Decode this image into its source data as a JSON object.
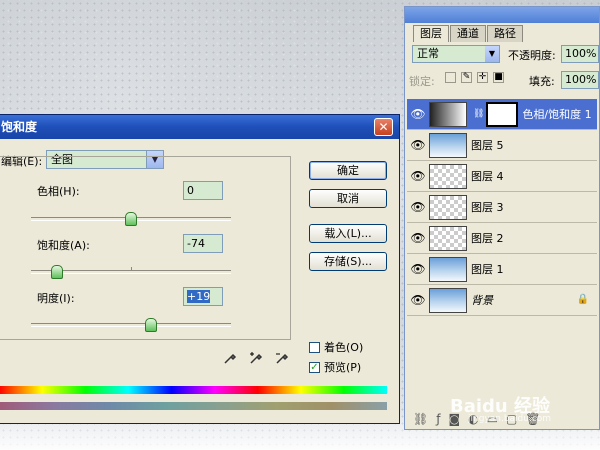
{
  "dialog": {
    "title": "饱和度",
    "close": "✕",
    "edit_label": "编辑(E):",
    "edit_value": "全图",
    "hue": {
      "label": "色相(H):",
      "value": "0"
    },
    "saturation": {
      "label": "饱和度(A):",
      "value": "-74"
    },
    "lightness": {
      "label": "明度(I):",
      "value": "+19"
    },
    "buttons": {
      "ok": "确定",
      "cancel": "取消",
      "load": "载入(L)...",
      "save": "存储(S)..."
    },
    "colorize": {
      "label": "着色(O)",
      "checked": false
    },
    "preview": {
      "label": "预览(P)",
      "checked": true
    }
  },
  "layers_panel": {
    "tabs": [
      "图层",
      "通道",
      "路径"
    ],
    "blend_mode": "正常",
    "opacity_label": "不透明度:",
    "opacity_value": "100%",
    "lock_label": "锁定:",
    "fill_label": "填充:",
    "fill_value": "100%",
    "layers": [
      {
        "name": "色相/饱和度 1",
        "type": "adjustment",
        "selected": true
      },
      {
        "name": "图层 5",
        "type": "image"
      },
      {
        "name": "图层 4",
        "type": "transparent"
      },
      {
        "name": "图层 3",
        "type": "transparent"
      },
      {
        "name": "图层 2",
        "type": "transparent"
      },
      {
        "name": "图层 1",
        "type": "image"
      },
      {
        "name": "背景",
        "type": "background",
        "locked": true
      }
    ]
  },
  "watermark": {
    "text": "Baidu 经验",
    "sub": "jingyan.baidu.com"
  }
}
